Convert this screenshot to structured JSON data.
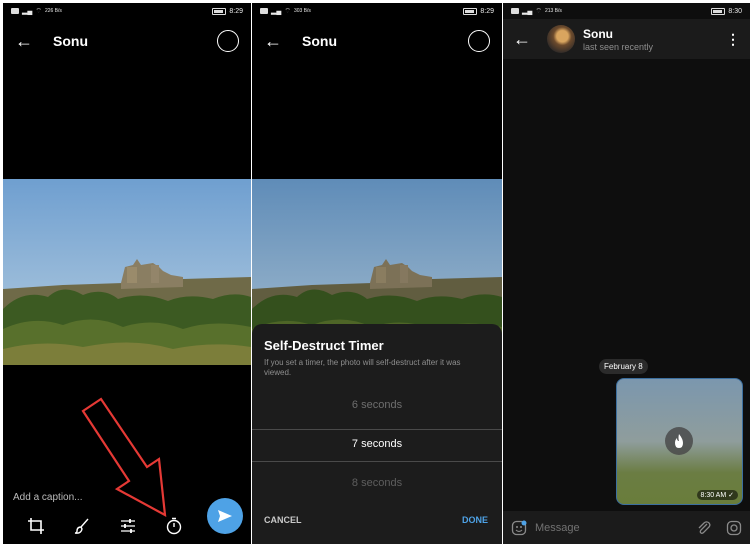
{
  "status": {
    "time1": "8:29",
    "time2": "8:29",
    "time3": "8:30",
    "speed1": "226 B/s",
    "speed2": "303 B/s",
    "speed3": "213 B/s"
  },
  "screen1": {
    "contact": "Sonu",
    "caption_placeholder": "Add a caption...",
    "tools": {
      "crop": "crop-icon",
      "brush": "brush-icon",
      "adjust": "adjust-icon",
      "timer": "timer-icon"
    }
  },
  "screen2": {
    "contact": "Sonu",
    "sheet": {
      "title": "Self-Destruct Timer",
      "description": "If you set a timer, the photo will self-destruct after it was viewed.",
      "options": [
        "6 seconds",
        "7 seconds",
        "8 seconds"
      ],
      "selected": "7 seconds",
      "cancel": "CANCEL",
      "done": "DONE"
    }
  },
  "screen3": {
    "contact": "Sonu",
    "status": "last seen recently",
    "date": "February 8",
    "message_time": "8:30 AM",
    "input_placeholder": "Message"
  },
  "colors": {
    "accent": "#4ea2e6",
    "sheet_bg": "#1c1c1c",
    "annotation_arrow": "#e53935"
  }
}
